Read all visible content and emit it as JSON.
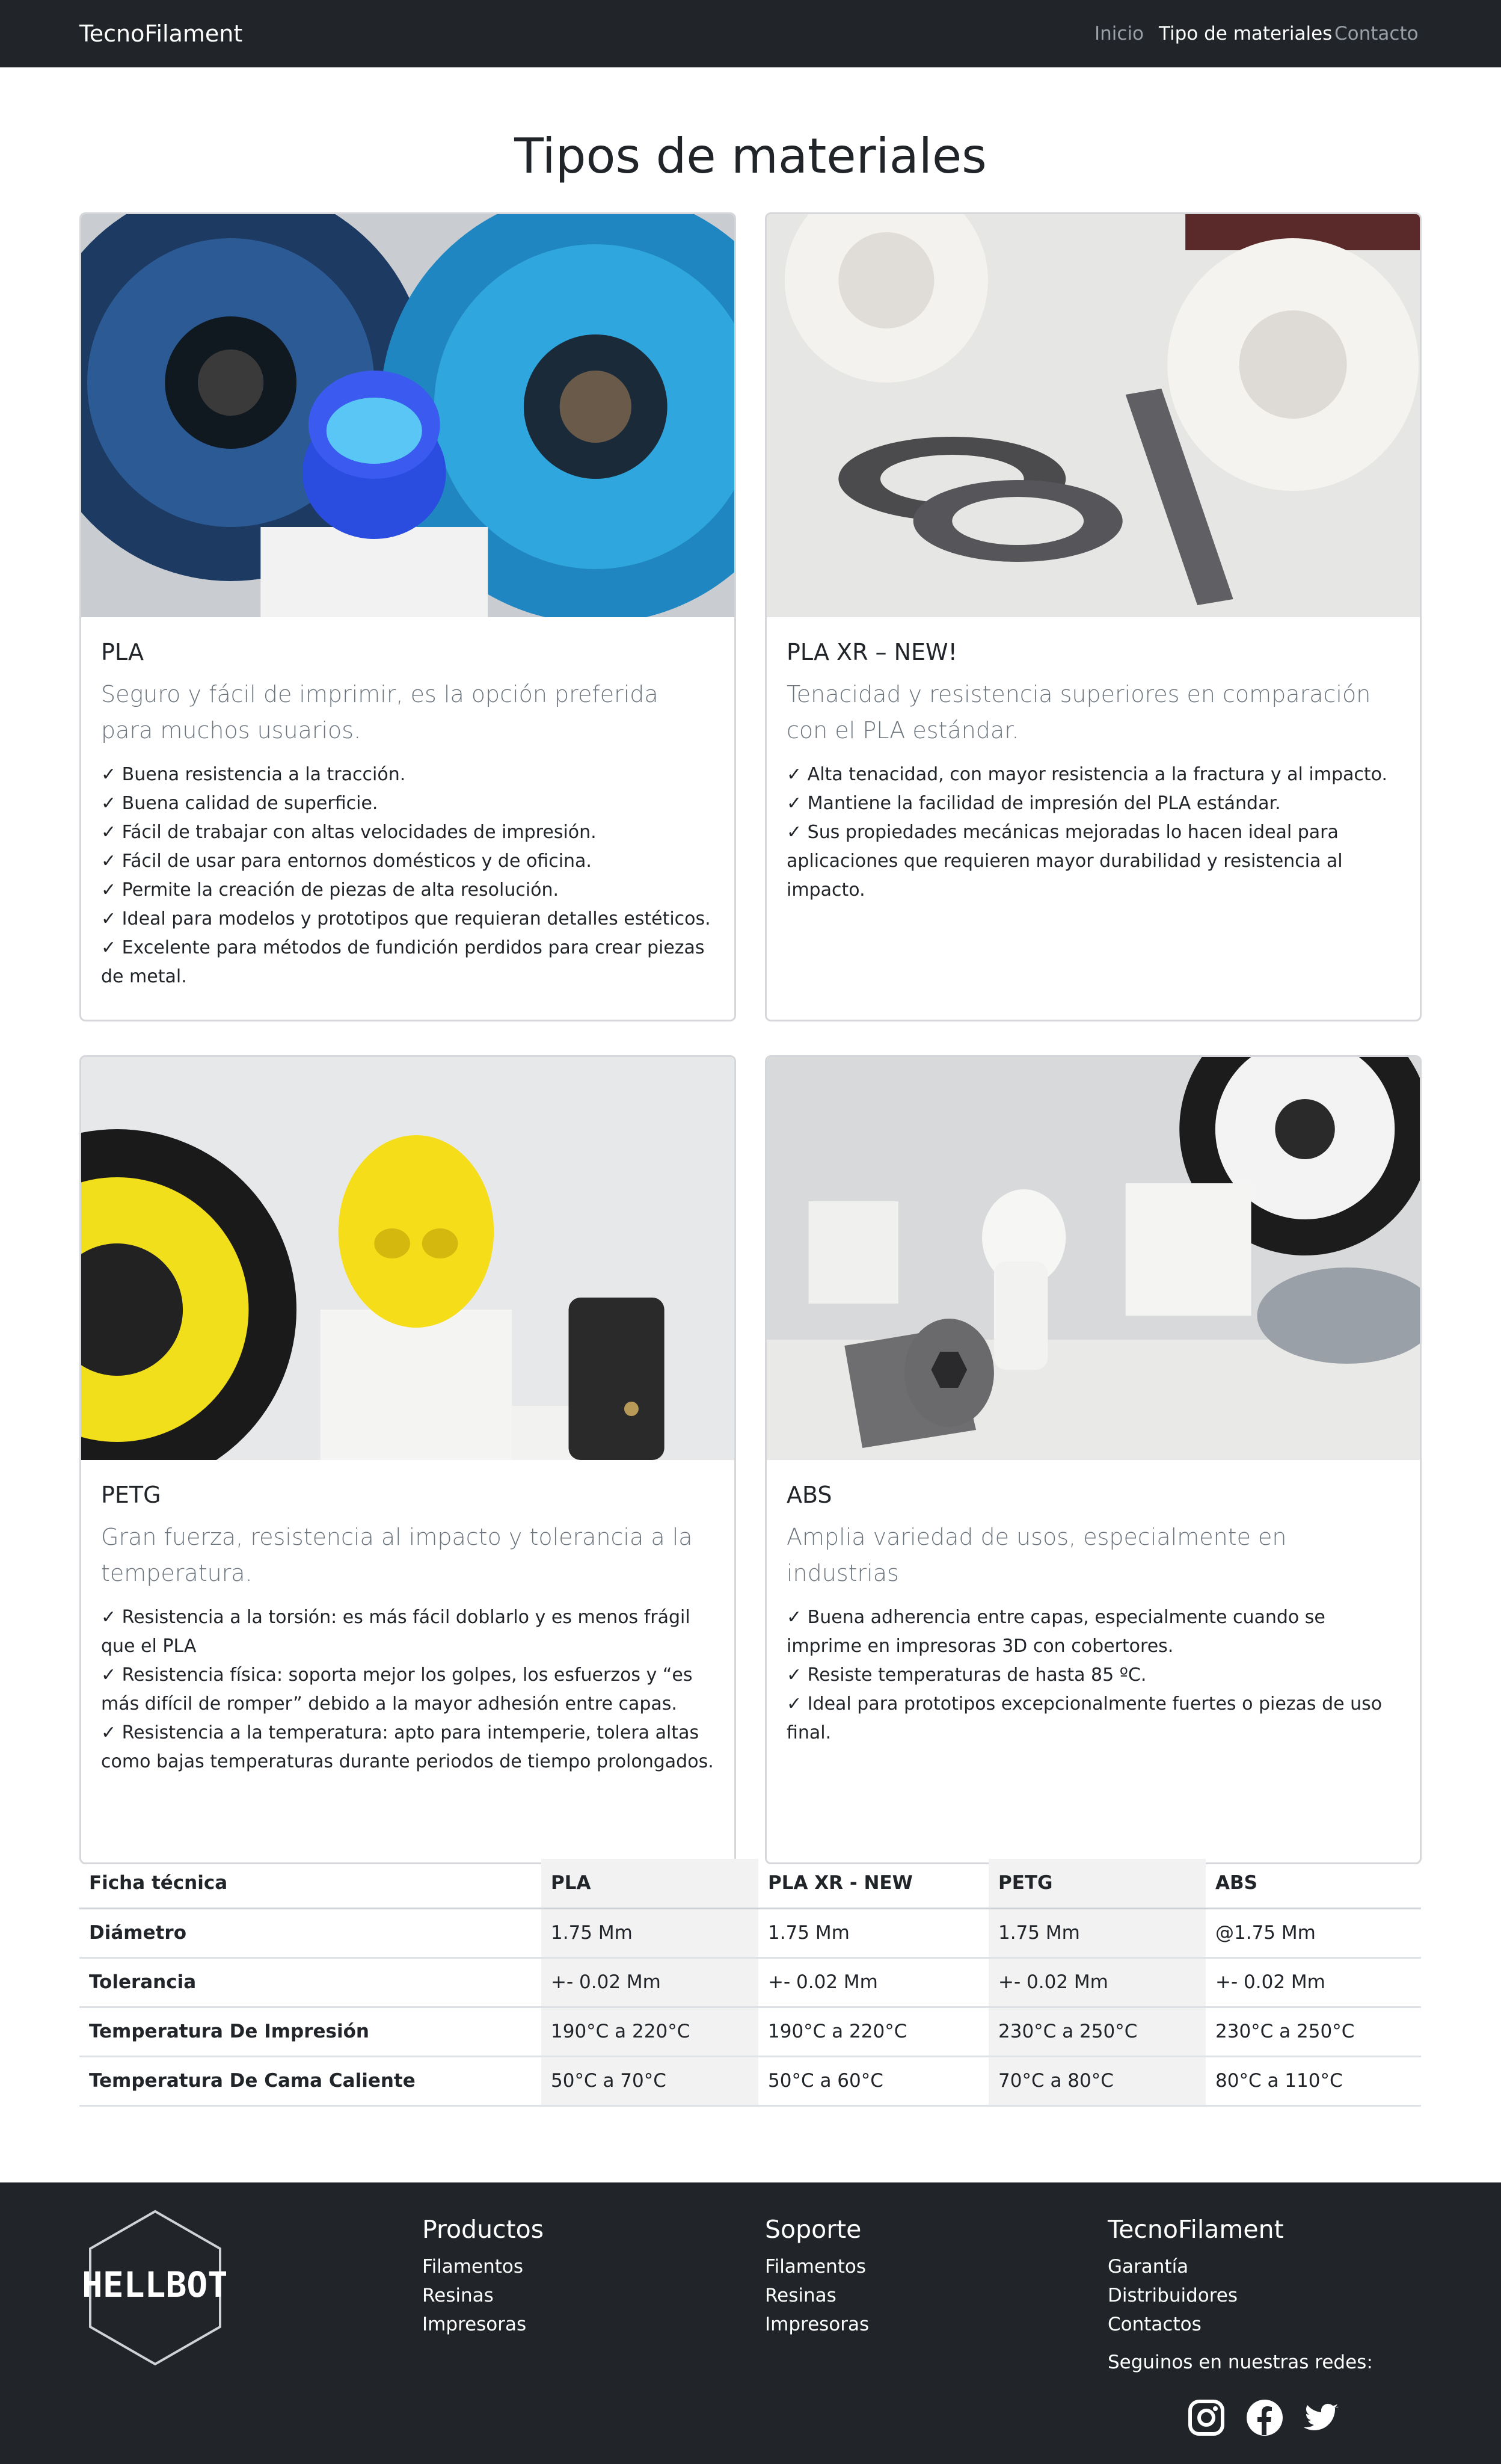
{
  "nav": {
    "brand": "TecnoFilament",
    "links": [
      "Inicio",
      "Tipo de materiales",
      "Contacto"
    ]
  },
  "page": {
    "title": "Tipos de materiales"
  },
  "cards": [
    {
      "title": "PLA",
      "lead": "Seguro y fácil de imprimir, es la opción preferida para muchos usuarios.",
      "features": [
        "✓ Buena resistencia a la tracción.",
        "✓ Buena calidad de superficie.",
        "✓ Fácil de trabajar con altas velocidades de impresión.",
        "✓ Fácil de usar para entornos domésticos y de oficina.",
        "✓ Permite la creación de piezas de alta resolución.",
        "✓ Ideal para modelos y prototipos que requieran detalles estéticos.",
        "✓ Excelente para métodos de fundición perdidos para crear piezas de metal."
      ]
    },
    {
      "title": "PLA XR – NEW!",
      "lead": "Tenacidad y resistencia superiores en comparación con el PLA estándar.",
      "features": [
        "✓ Alta tenacidad, con mayor resistencia a la fractura y al impacto.",
        "✓ Mantiene la facilidad de impresión del PLA estándar.",
        "✓ Sus propiedades mecánicas mejoradas lo hacen ideal para aplicaciones que requieren mayor durabilidad y resistencia al impacto."
      ]
    },
    {
      "title": "PETG",
      "lead": "Gran fuerza, resistencia al impacto y tolerancia a la temperatura.",
      "features": [
        "✓ Resistencia a la torsión: es más fácil doblarlo y es menos frágil que el PLA",
        "✓ Resistencia física: soporta mejor los golpes, los esfuerzos y “es más difícil de romper” debido a la mayor adhesión entre capas.",
        "✓ Resistencia a la temperatura: apto para intemperie, tolera altas como bajas temperaturas durante periodos de tiempo prolongados."
      ]
    },
    {
      "title": "ABS",
      "lead": "Amplia variedad de usos, especialmente en industrias",
      "features": [
        "✓ Buena adherencia entre capas, especialmente cuando se imprime en impresoras 3D con cobertores.",
        "✓ Resiste temperaturas de hasta 85 ºC.",
        "✓ Ideal para prototipos excepcionalmente fuertes o piezas de uso final."
      ]
    }
  ],
  "table": {
    "headers": [
      "Ficha técnica",
      "PLA",
      "PLA XR - NEW",
      "PETG",
      "ABS"
    ],
    "rows": [
      [
        "Diámetro",
        "1.75 Mm",
        "1.75 Mm",
        "1.75 Mm",
        "@1.75 Mm"
      ],
      [
        "Tolerancia",
        "+- 0.02 Mm",
        "+- 0.02 Mm",
        "+- 0.02 Mm",
        "+- 0.02 Mm"
      ],
      [
        "Temperatura De Impresión",
        "190°C a 220°C",
        "190°C a 220°C",
        "230°C a 250°C",
        "230°C a 250°C"
      ],
      [
        "Temperatura De Cama Caliente",
        "50°C a 70°C",
        "50°C a 60°C",
        "70°C a 80°C",
        "80°C a 110°C"
      ]
    ]
  },
  "footer": {
    "logo_text": "HELLBOT",
    "columns": [
      {
        "title": "Productos",
        "links": [
          "Filamentos",
          "Resinas",
          "Impresoras"
        ]
      },
      {
        "title": "Soporte",
        "links": [
          "Filamentos",
          "Resinas",
          "Impresoras"
        ]
      },
      {
        "title": "TecnoFilament",
        "links": [
          "Garantía",
          "Distribuidores",
          "Contactos"
        ]
      }
    ],
    "follow_text": "Seguinos en nuestras redes:",
    "social": [
      "instagram-icon",
      "facebook-icon",
      "twitter-icon"
    ]
  },
  "colors": {
    "navbar_bg": "#212529",
    "footer_bg": "#212529",
    "table_shade": "#f2f2f2",
    "lead_text": "#6c757d"
  }
}
